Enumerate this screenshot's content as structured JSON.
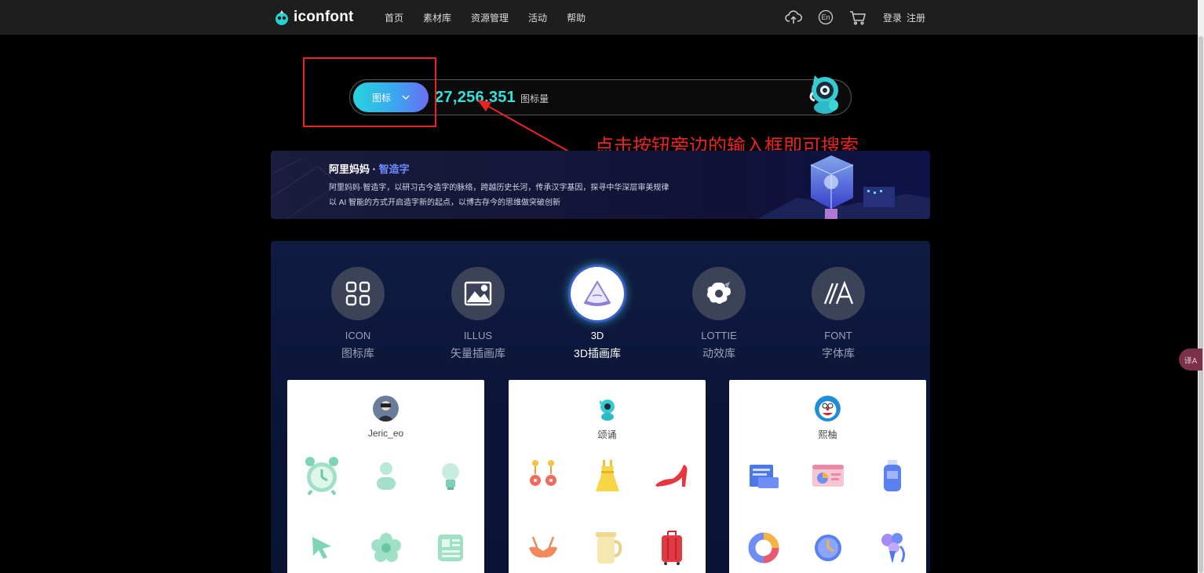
{
  "nav": {
    "logo_text": "iconfont",
    "links": [
      "首页",
      "素材库",
      "资源管理",
      "活动",
      "帮助"
    ],
    "icons": [
      "upload-cloud-icon",
      "language-en-icon",
      "cart-icon"
    ],
    "lang_badge": "En",
    "login": "登录",
    "register": "注册"
  },
  "search": {
    "type_label": "图标",
    "count": "27,256,351",
    "count_label": "图标量"
  },
  "annotation": {
    "text": "点击按钮旁边的输入框即可搜索",
    "color": "#e82424"
  },
  "banner": {
    "title_main": "阿里妈妈 · ",
    "title_highlight": "智造字",
    "line1": "阿里妈妈·智造字，以研习古今造字的脉络，跨越历史长河，传承汉字基因，探寻中华深层审美规律",
    "line2": "以 AI 智能的方式开启造字新的起点，以博古存今的思维做突破创新"
  },
  "categories": [
    {
      "en": "ICON",
      "cn": "图标库",
      "icon": "grid-icon",
      "active": false
    },
    {
      "en": "ILLUS",
      "cn": "矢量插画库",
      "icon": "image-icon",
      "active": false
    },
    {
      "en": "3D",
      "cn": "3D插画库",
      "icon": "cone-3d-icon",
      "active": true
    },
    {
      "en": "LOTTIE",
      "cn": "动效库",
      "icon": "lottie-icon",
      "active": false
    },
    {
      "en": "FONT",
      "cn": "字体库",
      "icon": "font-a-icon",
      "active": false
    }
  ],
  "cards": [
    {
      "user": "Jeric_eo",
      "icons": [
        "alarm-clock-icon",
        "person-icon",
        "lightbulb-icon",
        "cursor-arrow-icon",
        "flower-icon",
        "newspaper-icon"
      ]
    },
    {
      "user": "颂诵",
      "icons": [
        "earrings-icon",
        "dress-icon",
        "high-heel-icon",
        "bikini-top-icon",
        "kettle-icon",
        "suitcase-icon"
      ]
    },
    {
      "user": "熙柚",
      "icons": [
        "folder-docs-icon",
        "dashboard-window-icon",
        "bottle-icon",
        "donut-chart-icon",
        "clock-icon",
        "bouquet-icon"
      ]
    }
  ],
  "side_badge": "译A",
  "colors": {
    "accent": "#35e0d8",
    "button_gradient_start": "#28d3dd",
    "button_gradient_end": "#6a6df3",
    "highlight": "#6d8bff"
  }
}
